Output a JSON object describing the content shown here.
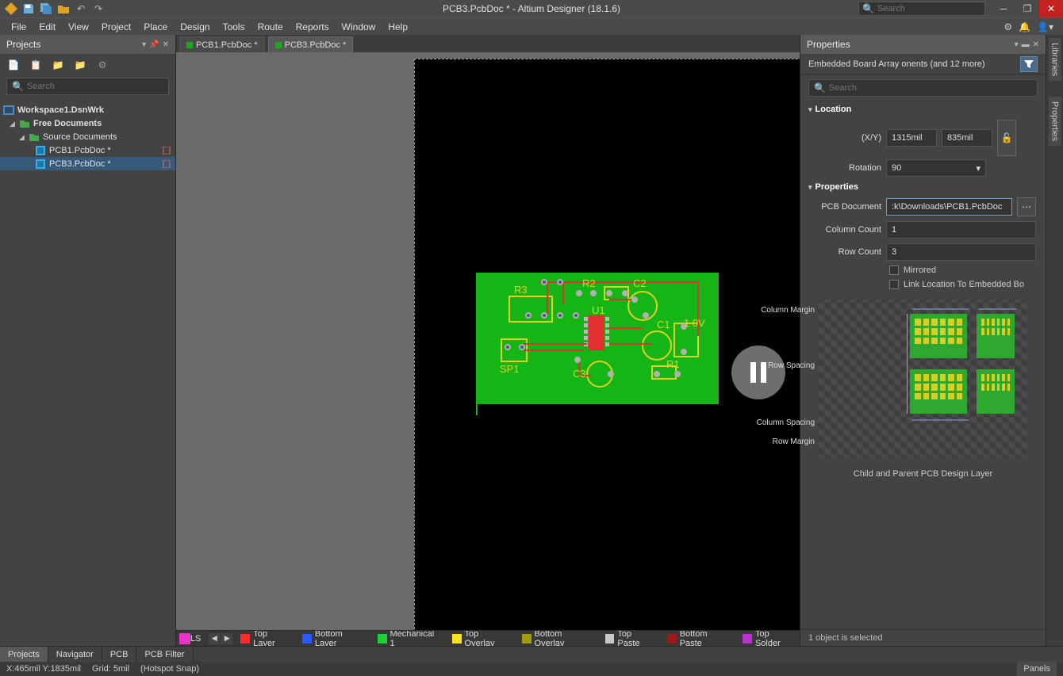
{
  "app": {
    "title": "PCB3.PcbDoc * - Altium Designer (18.1.6)",
    "search_placeholder": "Search"
  },
  "menus": [
    "File",
    "Edit",
    "View",
    "Project",
    "Place",
    "Design",
    "Tools",
    "Route",
    "Reports",
    "Window",
    "Help"
  ],
  "projects_panel": {
    "title": "Projects",
    "search_placeholder": "Search",
    "tree": {
      "workspace": "Workspace1.DsnWrk",
      "free_docs": "Free Documents",
      "source_docs": "Source Documents",
      "files": [
        {
          "name": "PCB1.PcbDoc *",
          "selected": false
        },
        {
          "name": "PCB3.PcbDoc *",
          "selected": true
        }
      ]
    }
  },
  "tabs": [
    {
      "label": "PCB1.PcbDoc *",
      "active": false
    },
    {
      "label": "PCB3.PcbDoc *",
      "active": true
    }
  ],
  "pcb_refs": [
    "R3",
    "R2",
    "C2",
    "U1",
    "C1",
    "1 0V",
    "SP1",
    "C3",
    "R1"
  ],
  "properties": {
    "title": "Properties",
    "filter_text": "Embedded Board Array   onents (and 12 more)",
    "search_placeholder": "Search",
    "location_label": "Location",
    "xy_label": "(X/Y)",
    "x": "1315mil",
    "y": "835mil",
    "rotation_label": "Rotation",
    "rotation": "90",
    "props_label": "Properties",
    "pcbdoc_label": "PCB Document",
    "pcbdoc": ":k\\Downloads\\PCB1.PcbDoc",
    "colcount_label": "Column Count",
    "colcount": "1",
    "rowcount_label": "Row Count",
    "rowcount": "3",
    "mirrored": "Mirrored",
    "linkloc": "Link Location To Embedded Bo",
    "colmargin": "Column Margin",
    "rowspacing": "Row Spacing",
    "colspacing": "Column Spacing",
    "rowmargin": "Row Margin",
    "childparent": "Child and Parent PCB Design Layer",
    "footer": "1 object is selected"
  },
  "right_tabs": [
    "Libraries",
    "Properties"
  ],
  "bottom_tabs": [
    "Projects",
    "Navigator",
    "PCB",
    "PCB Filter"
  ],
  "layers": [
    {
      "name": "LS",
      "color": "#eb33cc",
      "type": "sel"
    },
    {
      "name": "Top Layer",
      "color": "#ff2a2a"
    },
    {
      "name": "Bottom Layer",
      "color": "#2a5aff"
    },
    {
      "name": "Mechanical 1",
      "color": "#1ece3a"
    },
    {
      "name": "Top Overlay",
      "color": "#f7e21b"
    },
    {
      "name": "Bottom Overlay",
      "color": "#a39a14"
    },
    {
      "name": "Top Paste",
      "color": "#c8c8c8"
    },
    {
      "name": "Bottom Paste",
      "color": "#9a1a1a"
    },
    {
      "name": "Top Solder",
      "color": "#b733cc"
    }
  ],
  "status": {
    "coords": "X:465mil Y:1835mil",
    "grid": "Grid: 5mil",
    "snap": "(Hotspot Snap)",
    "panels": "Panels"
  }
}
